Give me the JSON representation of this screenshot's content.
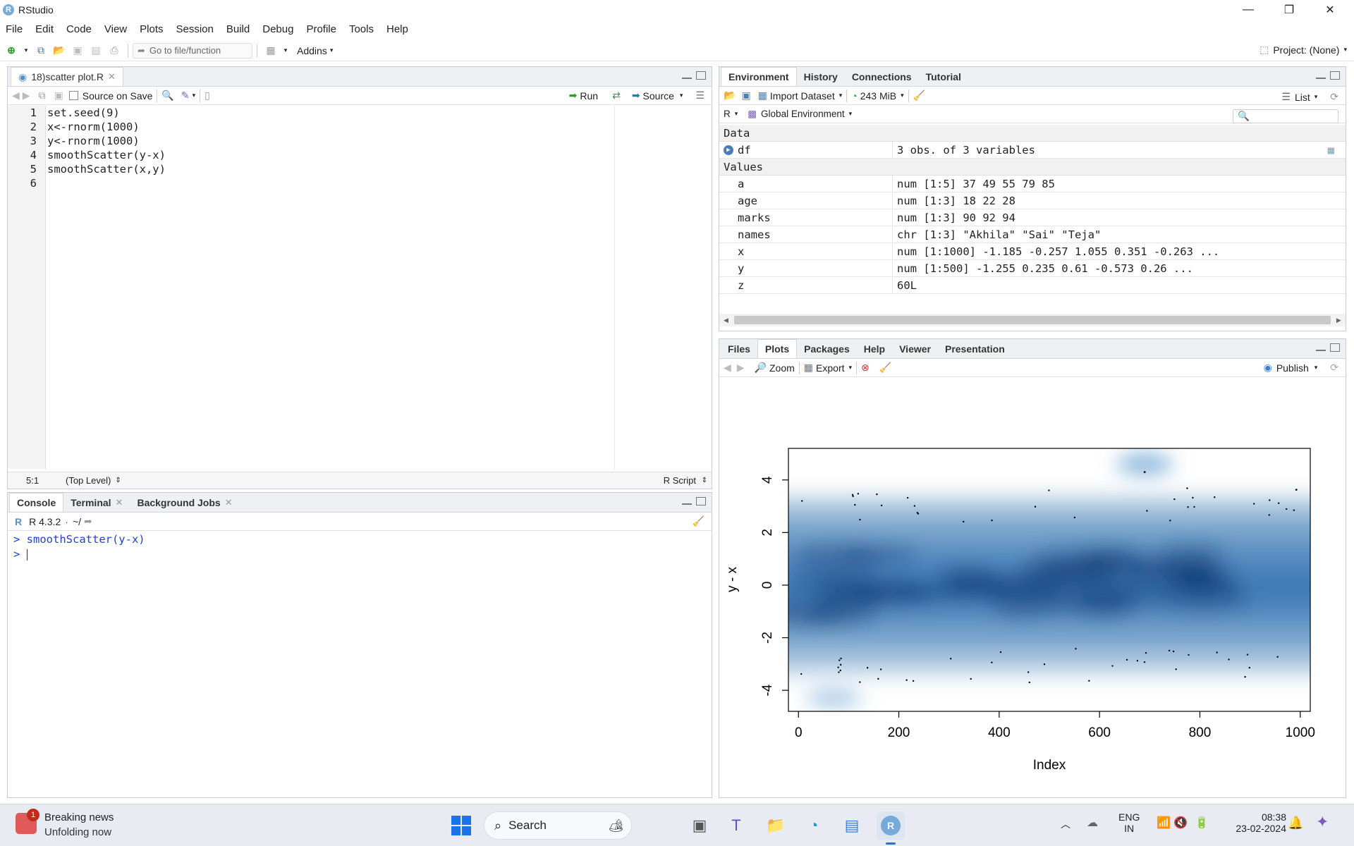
{
  "window": {
    "title": "RStudio"
  },
  "menu": [
    "File",
    "Edit",
    "Code",
    "View",
    "Plots",
    "Session",
    "Build",
    "Debug",
    "Profile",
    "Tools",
    "Help"
  ],
  "toolbar": {
    "goto_placeholder": "Go to file/function",
    "addins": "Addins",
    "project": "Project: (None)"
  },
  "editor": {
    "tab": "18)scatter plot.R",
    "source_on_save": "Source on Save",
    "run": "Run",
    "source": "Source",
    "lines": [
      "set.seed(9)",
      "x<-rnorm(1000)",
      "y<-rnorm(1000)",
      "smoothScatter(y-x)",
      "smoothScatter(x,y)",
      ""
    ],
    "line_numbers": [
      "1",
      "2",
      "3",
      "4",
      "5",
      "6"
    ],
    "status_pos": "5:1",
    "status_scope": "(Top Level)",
    "status_type": "R Script"
  },
  "console": {
    "tabs": [
      "Console",
      "Terminal",
      "Background Jobs"
    ],
    "version": "R 4.3.2",
    "path": "~/",
    "lines": [
      "> smoothScatter(y-x)",
      "> "
    ]
  },
  "env": {
    "tabs": [
      "Environment",
      "History",
      "Connections",
      "Tutorial"
    ],
    "import": "Import Dataset",
    "memory": "243 MiB",
    "list": "List",
    "lang": "R",
    "scope": "Global Environment",
    "data_header": "Data",
    "values_header": "Values",
    "data": [
      {
        "name": "df",
        "value": "3 obs. of 3 variables"
      }
    ],
    "values": [
      {
        "name": "a",
        "value": "num [1:5] 37 49 55 79 85"
      },
      {
        "name": "age",
        "value": "num [1:3] 18 22 28"
      },
      {
        "name": "marks",
        "value": "num [1:3] 90 92 94"
      },
      {
        "name": "names",
        "value": "chr [1:3] \"Akhila\" \"Sai\" \"Teja\""
      },
      {
        "name": "x",
        "value": "num [1:1000] -1.185 -0.257 1.055 0.351 -0.263 ..."
      },
      {
        "name": "y",
        "value": "num [1:500] -1.255 0.235 0.61 -0.573 0.26 ..."
      },
      {
        "name": "z",
        "value": "60L"
      }
    ]
  },
  "files": {
    "tabs": [
      "Files",
      "Plots",
      "Packages",
      "Help",
      "Viewer",
      "Presentation"
    ],
    "zoom": "Zoom",
    "export": "Export",
    "publish": "Publish"
  },
  "chart_data": {
    "type": "heatmap",
    "title": "",
    "xlabel": "Index",
    "ylabel": "y - x",
    "xlim": [
      -20,
      1020
    ],
    "ylim": [
      -4.8,
      5.2
    ],
    "xticks": [
      "0",
      "200",
      "400",
      "600",
      "800",
      "1000"
    ],
    "yticks": [
      "-4",
      "-2",
      "0",
      "2",
      "4"
    ],
    "colormap": [
      "#ffffff",
      "#08306b"
    ],
    "grid": false
  },
  "taskbar": {
    "news_title": "Breaking news",
    "news_sub": "Unfolding now",
    "news_badge": "1",
    "search": "Search",
    "lang1": "ENG",
    "lang2": "IN",
    "time": "08:38",
    "date": "23-02-2024"
  }
}
